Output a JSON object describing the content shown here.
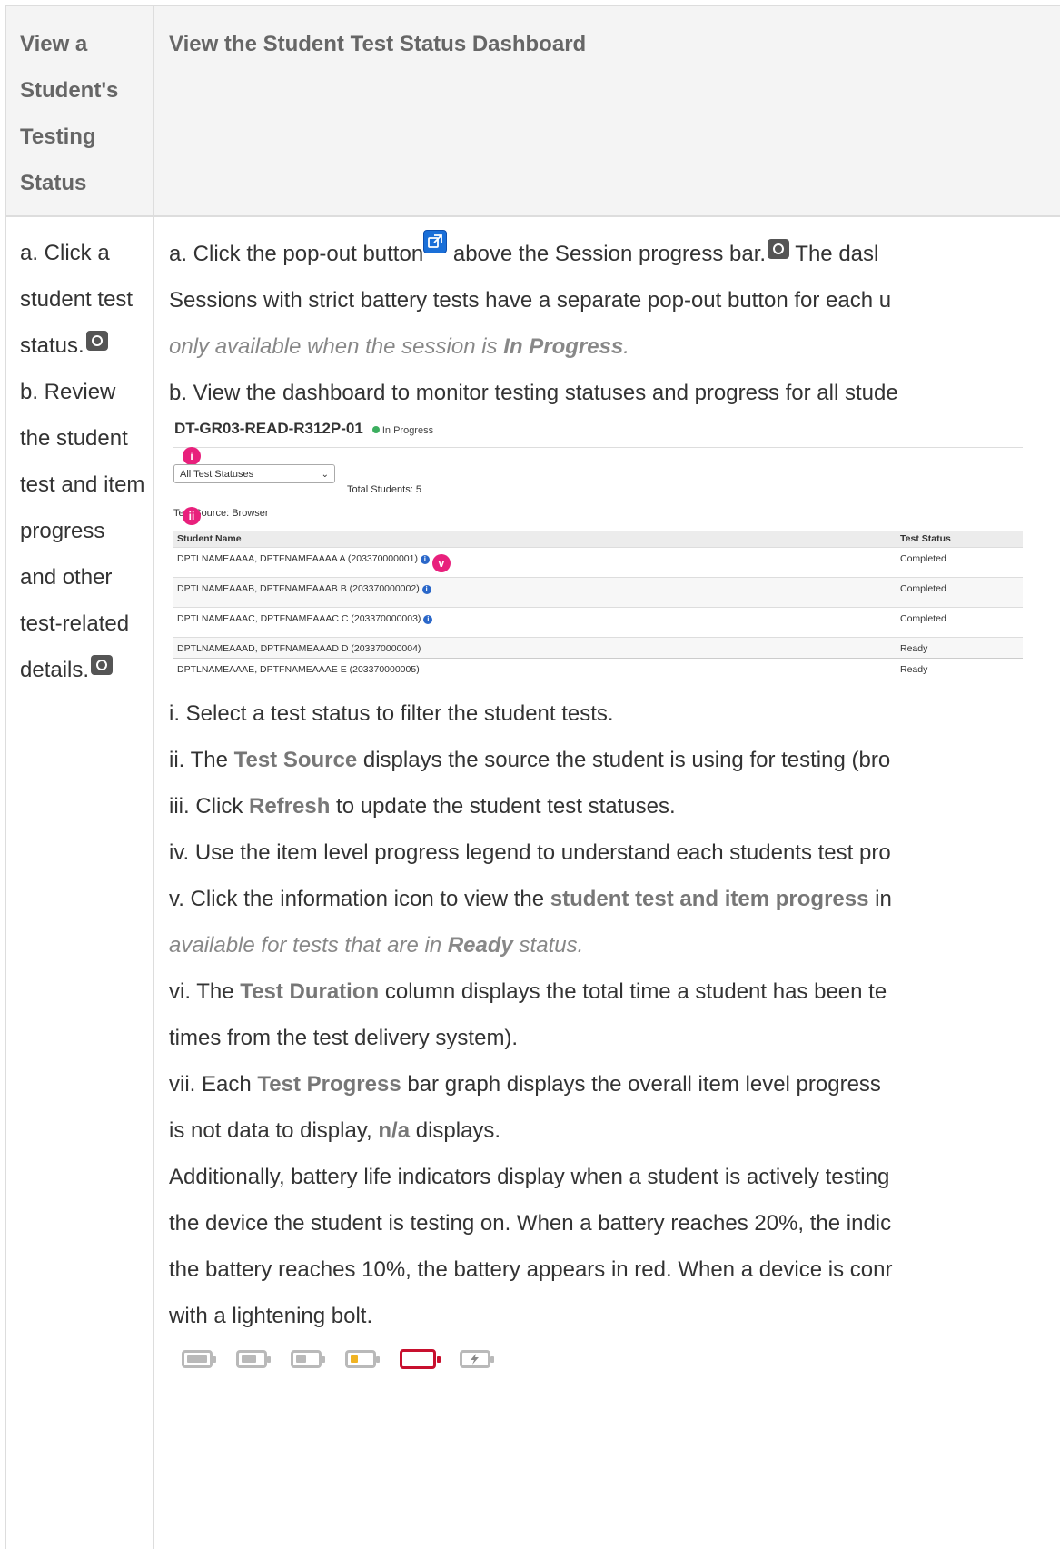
{
  "header": {
    "col1": "View a Student's Testing Status",
    "col2": "View the Student Test Status Dashboard"
  },
  "col1": {
    "a": "a. Click a student test status.",
    "b": "b. Review the student test and item progress and other test-related details."
  },
  "col2": {
    "a_part1": "a. Click the pop-out button",
    "a_part2": " above the Session progress bar.",
    "a_part3": " The dasl",
    "a_line2": "Sessions with strict battery tests have a separate pop-out button for each u",
    "a_note_part1": "only available when the session is ",
    "a_note_bold": "In Progress",
    "a_note_part2": ".",
    "b_line": "b. View the dashboard to monitor testing statuses and progress for all stude"
  },
  "shot": {
    "title": "DT-GR03-READ-R312P-01",
    "status": "In Progress",
    "marker_i": "i",
    "marker_ii": "ii",
    "marker_v": "v",
    "filter_value": "All Test Statuses",
    "total": "Total Students: 5",
    "source": "Test Source: Browser",
    "col_name": "Student Name",
    "col_status": "Test Status",
    "rows": [
      {
        "name": "DPTLNAMEAAAA, DPTFNAMEAAAA A (203370000001)",
        "status": "Completed"
      },
      {
        "name": "DPTLNAMEAAAB, DPTFNAMEAAAB B (203370000002)",
        "status": "Completed"
      },
      {
        "name": "DPTLNAMEAAAC, DPTFNAMEAAAC C (203370000003)",
        "status": "Completed"
      },
      {
        "name": "DPTLNAMEAAAD, DPTFNAMEAAAD D (203370000004)",
        "status": "Ready"
      },
      {
        "name": "DPTLNAMEAAAE, DPTFNAMEAAAE E (203370000005)",
        "status": "Ready"
      }
    ]
  },
  "steps": {
    "i": "i. Select a test status to filter the student tests.",
    "ii_a": "ii. The ",
    "ii_kw": "Test Source",
    "ii_b": " displays the source the student is using for testing (bro",
    "iii_a": "iii. Click ",
    "iii_kw": "Refresh",
    "iii_b": " to update the student test statuses.",
    "iv": "iv. Use the item level progress legend to understand each students test pro",
    "v_a": "v. Click the information icon to view the ",
    "v_kw": "student test and item progress",
    "v_b": " in",
    "v_note_a": "available for tests that are in ",
    "v_note_kw": "Ready",
    "v_note_b": " status.",
    "vi_a": "vi. The ",
    "vi_kw": "Test Duration",
    "vi_b": " column displays the total time a student has been te",
    "vi_line2": "times from the test delivery system).",
    "vii_a": "vii. Each ",
    "vii_kw": "Test Progress",
    "vii_b": " bar graph displays the overall item level progress",
    "vii_line2_kw": "n/a",
    "vii_line2_a": "is not data to display, ",
    "vii_line2_b": " displays.",
    "add_1": "Additionally, battery life indicators display when a student is actively testing",
    "add_2": "the device the student is testing on. When a battery reaches 20%, the indic",
    "add_3": "the battery reaches 10%, the battery appears in red. When a device is conr",
    "add_4": "with a lightening bolt."
  },
  "batteries": {
    "levels": [
      1.0,
      0.75,
      0.5,
      0.25,
      0.1,
      "charging"
    ],
    "colors": {
      "normal": "#b9b9b9",
      "warning": "#f0b323",
      "critical": "#c8102e"
    }
  }
}
